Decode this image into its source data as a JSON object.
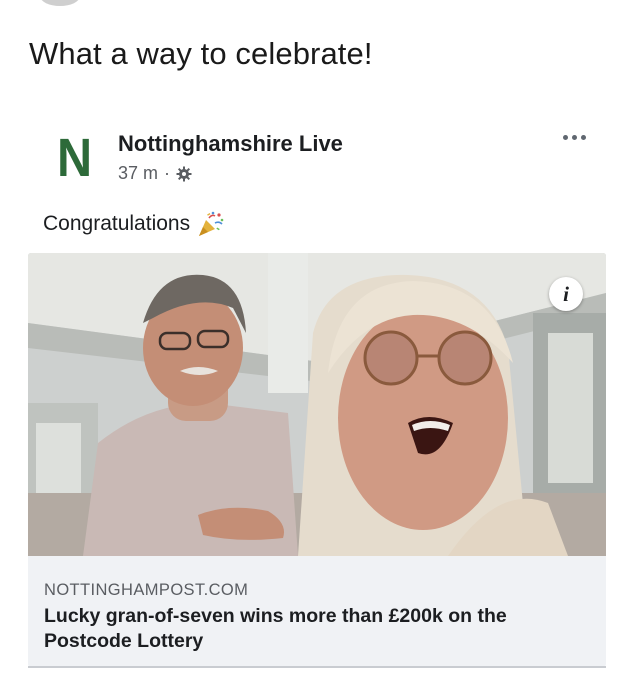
{
  "caption": "What a way to celebrate!",
  "post": {
    "page_name": "Nottinghamshire Live",
    "avatar_letter": "N",
    "time": "37 m",
    "separator": "·",
    "privacy_icon": "gear-icon",
    "more_icon": "more-options-icon",
    "text": "Congratulations",
    "emoji_icon": "party-popper-icon"
  },
  "link_card": {
    "info_icon": "info-icon",
    "info_glyph": "i",
    "domain": "NOTTINGHAMPOST.COM",
    "headline": "Lucky gran-of-seven wins more than £200k on the Postcode Lottery"
  },
  "colors": {
    "brand_green": "#2d6a39",
    "text_primary": "#1c1e21",
    "text_secondary": "#5a5d62",
    "card_bg": "#f0f2f5"
  }
}
